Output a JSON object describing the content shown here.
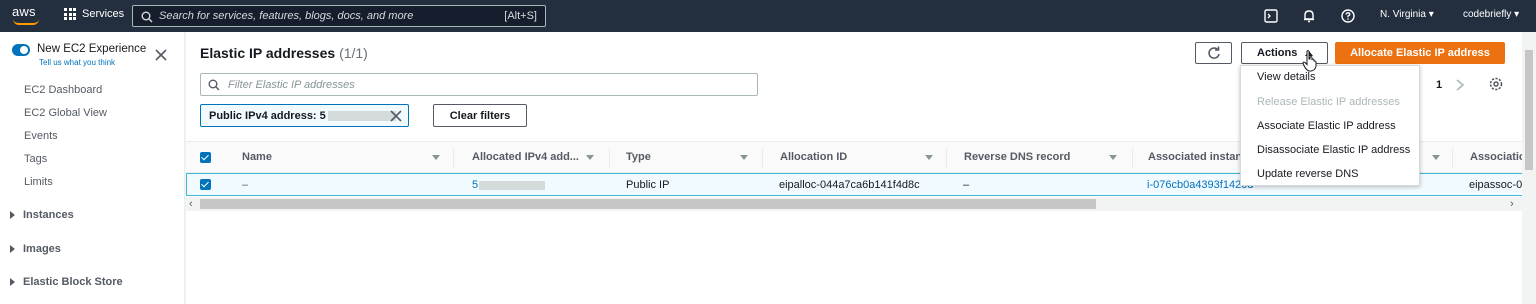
{
  "topnav": {
    "logo": "aws",
    "services_label": "Services",
    "search_placeholder": "Search for services, features, blogs, docs, and more",
    "search_shortcut": "[Alt+S]",
    "region": "N. Virginia",
    "account": "codebriefly",
    "icons": [
      "cloudshell-icon",
      "bell-icon",
      "help-icon"
    ]
  },
  "sidebar": {
    "experience_title": "New EC2 Experience",
    "experience_subtitle": "Tell us what you think",
    "links": [
      "EC2 Dashboard",
      "EC2 Global View",
      "Events",
      "Tags",
      "Limits"
    ],
    "sections": [
      "Instances",
      "Images",
      "Elastic Block Store"
    ]
  },
  "main": {
    "title": "Elastic IP addresses",
    "count": "(1/1)",
    "actions_label": "Actions",
    "allocate_label": "Allocate Elastic IP address",
    "filter_placeholder": "Filter Elastic IP addresses",
    "token_label": "Public IPv4 address: 5",
    "clear_filters_label": "Clear filters",
    "page_number": "1"
  },
  "table": {
    "columns": [
      "Name",
      "Allocated IPv4 add...",
      "Type",
      "Allocation ID",
      "Reverse DNS record",
      "Associated instanc",
      "Associatio"
    ],
    "row": {
      "name": "–",
      "ipv4": "5",
      "type": "Public IP",
      "allocation_id": "eipalloc-044a7ca6b141f4d8c",
      "reverse_dns": "–",
      "instance": "i-076cb0a4393f1420d",
      "association": "eipassoc-0"
    }
  },
  "actions_menu": {
    "items": [
      {
        "label": "View details",
        "disabled": false
      },
      {
        "label": "Release Elastic IP addresses",
        "disabled": true
      },
      {
        "label": "Associate Elastic IP address",
        "disabled": false
      },
      {
        "label": "Disassociate Elastic IP address",
        "disabled": false
      },
      {
        "label": "Update reverse DNS",
        "disabled": false
      }
    ]
  },
  "colors": {
    "nav_bg": "#232f3e",
    "accent_orange": "#ec7211",
    "link_blue": "#0073bb",
    "selected_row_bg": "#f1faff"
  }
}
